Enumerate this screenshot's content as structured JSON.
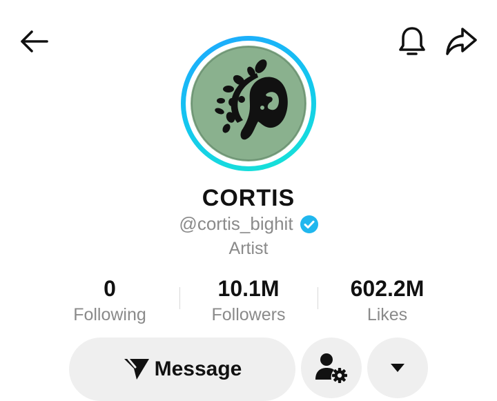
{
  "profile": {
    "name": "CORTIS",
    "handle": "@cortis_bighit",
    "bio": "Artist",
    "verified": true
  },
  "stats": [
    {
      "value": "0",
      "label": "Following"
    },
    {
      "value": "10.1M",
      "label": "Followers"
    },
    {
      "value": "602.2M",
      "label": "Likes"
    }
  ],
  "actions": {
    "message_label": "Message"
  },
  "icons": {
    "back": "arrow-left-icon",
    "notification": "bell-icon",
    "share": "share-arrow-icon",
    "message": "paper-plane-icon",
    "manage": "user-gear-icon",
    "more": "caret-down-icon"
  },
  "colors": {
    "ring_start": "#1fa7ff",
    "ring_end": "#17e6d4",
    "verified": "#20b7ee",
    "avatar_bg": "#8ab18e",
    "muted_text": "#8a8a8a",
    "button_bg": "#efefef"
  }
}
